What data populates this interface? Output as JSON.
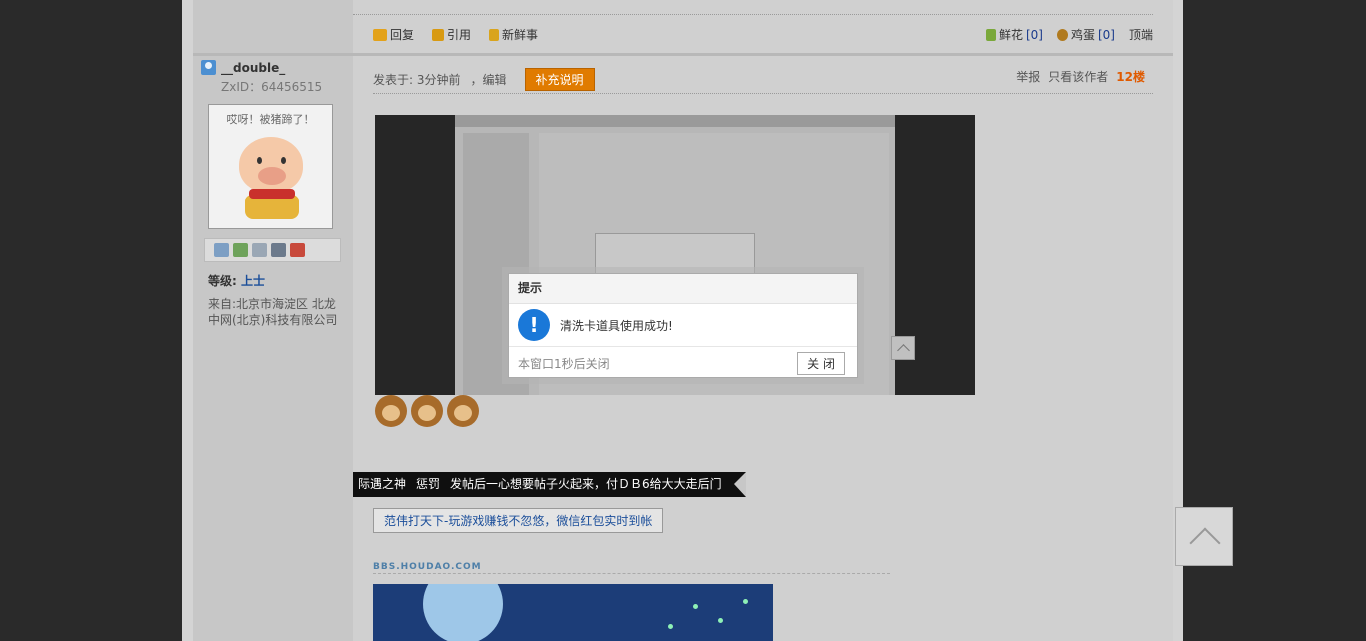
{
  "actions": {
    "reply": "回复",
    "quote": "引用",
    "fresh": "新鲜事"
  },
  "right_actions": {
    "flower_label": "鲜花",
    "flower_count": "[0]",
    "egg_label": "鸡蛋",
    "egg_count": "[0]",
    "top": "顶端"
  },
  "user": {
    "name": "__double_",
    "zxid": "ZxID：64456515",
    "avatar_caption": "哎呀！被猪蹄了！",
    "level_label": "等级:",
    "level_value": "上士",
    "from": "来自:北京市海淀区 北龙中网(北京)科技有限公司"
  },
  "post": {
    "posted": "发表于: 3分钟前",
    "edit": "，编辑",
    "supplement": "补充说明",
    "report": "举报",
    "only_author": "只看该作者",
    "floor": "12楼"
  },
  "modal": {
    "title": "提示",
    "message": "清洗卡道具使用成功!",
    "countdown": "本窗口1秒后关闭",
    "close": "关 闭"
  },
  "punish": {
    "user": "际遇之神",
    "type": "惩罚",
    "text": "发帖后一心想要帖子火起来，付ＤＢ6给大大走后门"
  },
  "ad_link": "范伟打天下-玩游戏赚钱不忽悠，微信红包实时到帐",
  "signature_site": "BBS.HOUDAO.COM",
  "icons": [
    "reply-icon",
    "quote-icon",
    "fresh-icon",
    "flower-icon",
    "egg-icon",
    "user-icon",
    "message-icon",
    "add-friend-icon",
    "view-icon",
    "profile-icon",
    "gift-icon",
    "info-icon",
    "back-to-top-icon"
  ]
}
